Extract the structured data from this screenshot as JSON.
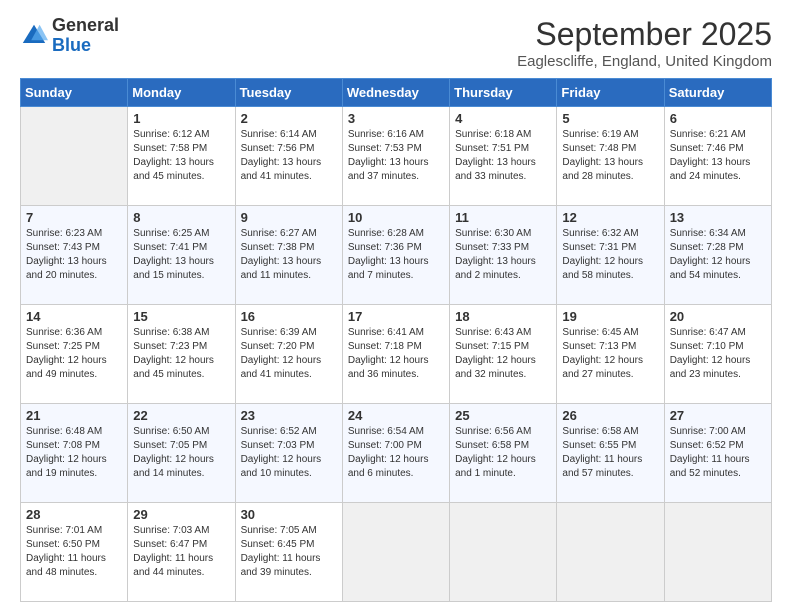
{
  "logo": {
    "general": "General",
    "blue": "Blue"
  },
  "header": {
    "month": "September 2025",
    "location": "Eaglescliffe, England, United Kingdom"
  },
  "weekdays": [
    "Sunday",
    "Monday",
    "Tuesday",
    "Wednesday",
    "Thursday",
    "Friday",
    "Saturday"
  ],
  "weeks": [
    [
      {
        "day": "",
        "info": ""
      },
      {
        "day": "1",
        "info": "Sunrise: 6:12 AM\nSunset: 7:58 PM\nDaylight: 13 hours\nand 45 minutes."
      },
      {
        "day": "2",
        "info": "Sunrise: 6:14 AM\nSunset: 7:56 PM\nDaylight: 13 hours\nand 41 minutes."
      },
      {
        "day": "3",
        "info": "Sunrise: 6:16 AM\nSunset: 7:53 PM\nDaylight: 13 hours\nand 37 minutes."
      },
      {
        "day": "4",
        "info": "Sunrise: 6:18 AM\nSunset: 7:51 PM\nDaylight: 13 hours\nand 33 minutes."
      },
      {
        "day": "5",
        "info": "Sunrise: 6:19 AM\nSunset: 7:48 PM\nDaylight: 13 hours\nand 28 minutes."
      },
      {
        "day": "6",
        "info": "Sunrise: 6:21 AM\nSunset: 7:46 PM\nDaylight: 13 hours\nand 24 minutes."
      }
    ],
    [
      {
        "day": "7",
        "info": "Sunrise: 6:23 AM\nSunset: 7:43 PM\nDaylight: 13 hours\nand 20 minutes."
      },
      {
        "day": "8",
        "info": "Sunrise: 6:25 AM\nSunset: 7:41 PM\nDaylight: 13 hours\nand 15 minutes."
      },
      {
        "day": "9",
        "info": "Sunrise: 6:27 AM\nSunset: 7:38 PM\nDaylight: 13 hours\nand 11 minutes."
      },
      {
        "day": "10",
        "info": "Sunrise: 6:28 AM\nSunset: 7:36 PM\nDaylight: 13 hours\nand 7 minutes."
      },
      {
        "day": "11",
        "info": "Sunrise: 6:30 AM\nSunset: 7:33 PM\nDaylight: 13 hours\nand 2 minutes."
      },
      {
        "day": "12",
        "info": "Sunrise: 6:32 AM\nSunset: 7:31 PM\nDaylight: 12 hours\nand 58 minutes."
      },
      {
        "day": "13",
        "info": "Sunrise: 6:34 AM\nSunset: 7:28 PM\nDaylight: 12 hours\nand 54 minutes."
      }
    ],
    [
      {
        "day": "14",
        "info": "Sunrise: 6:36 AM\nSunset: 7:25 PM\nDaylight: 12 hours\nand 49 minutes."
      },
      {
        "day": "15",
        "info": "Sunrise: 6:38 AM\nSunset: 7:23 PM\nDaylight: 12 hours\nand 45 minutes."
      },
      {
        "day": "16",
        "info": "Sunrise: 6:39 AM\nSunset: 7:20 PM\nDaylight: 12 hours\nand 41 minutes."
      },
      {
        "day": "17",
        "info": "Sunrise: 6:41 AM\nSunset: 7:18 PM\nDaylight: 12 hours\nand 36 minutes."
      },
      {
        "day": "18",
        "info": "Sunrise: 6:43 AM\nSunset: 7:15 PM\nDaylight: 12 hours\nand 32 minutes."
      },
      {
        "day": "19",
        "info": "Sunrise: 6:45 AM\nSunset: 7:13 PM\nDaylight: 12 hours\nand 27 minutes."
      },
      {
        "day": "20",
        "info": "Sunrise: 6:47 AM\nSunset: 7:10 PM\nDaylight: 12 hours\nand 23 minutes."
      }
    ],
    [
      {
        "day": "21",
        "info": "Sunrise: 6:48 AM\nSunset: 7:08 PM\nDaylight: 12 hours\nand 19 minutes."
      },
      {
        "day": "22",
        "info": "Sunrise: 6:50 AM\nSunset: 7:05 PM\nDaylight: 12 hours\nand 14 minutes."
      },
      {
        "day": "23",
        "info": "Sunrise: 6:52 AM\nSunset: 7:03 PM\nDaylight: 12 hours\nand 10 minutes."
      },
      {
        "day": "24",
        "info": "Sunrise: 6:54 AM\nSunset: 7:00 PM\nDaylight: 12 hours\nand 6 minutes."
      },
      {
        "day": "25",
        "info": "Sunrise: 6:56 AM\nSunset: 6:58 PM\nDaylight: 12 hours\nand 1 minute."
      },
      {
        "day": "26",
        "info": "Sunrise: 6:58 AM\nSunset: 6:55 PM\nDaylight: 11 hours\nand 57 minutes."
      },
      {
        "day": "27",
        "info": "Sunrise: 7:00 AM\nSunset: 6:52 PM\nDaylight: 11 hours\nand 52 minutes."
      }
    ],
    [
      {
        "day": "28",
        "info": "Sunrise: 7:01 AM\nSunset: 6:50 PM\nDaylight: 11 hours\nand 48 minutes."
      },
      {
        "day": "29",
        "info": "Sunrise: 7:03 AM\nSunset: 6:47 PM\nDaylight: 11 hours\nand 44 minutes."
      },
      {
        "day": "30",
        "info": "Sunrise: 7:05 AM\nSunset: 6:45 PM\nDaylight: 11 hours\nand 39 minutes."
      },
      {
        "day": "",
        "info": ""
      },
      {
        "day": "",
        "info": ""
      },
      {
        "day": "",
        "info": ""
      },
      {
        "day": "",
        "info": ""
      }
    ]
  ]
}
